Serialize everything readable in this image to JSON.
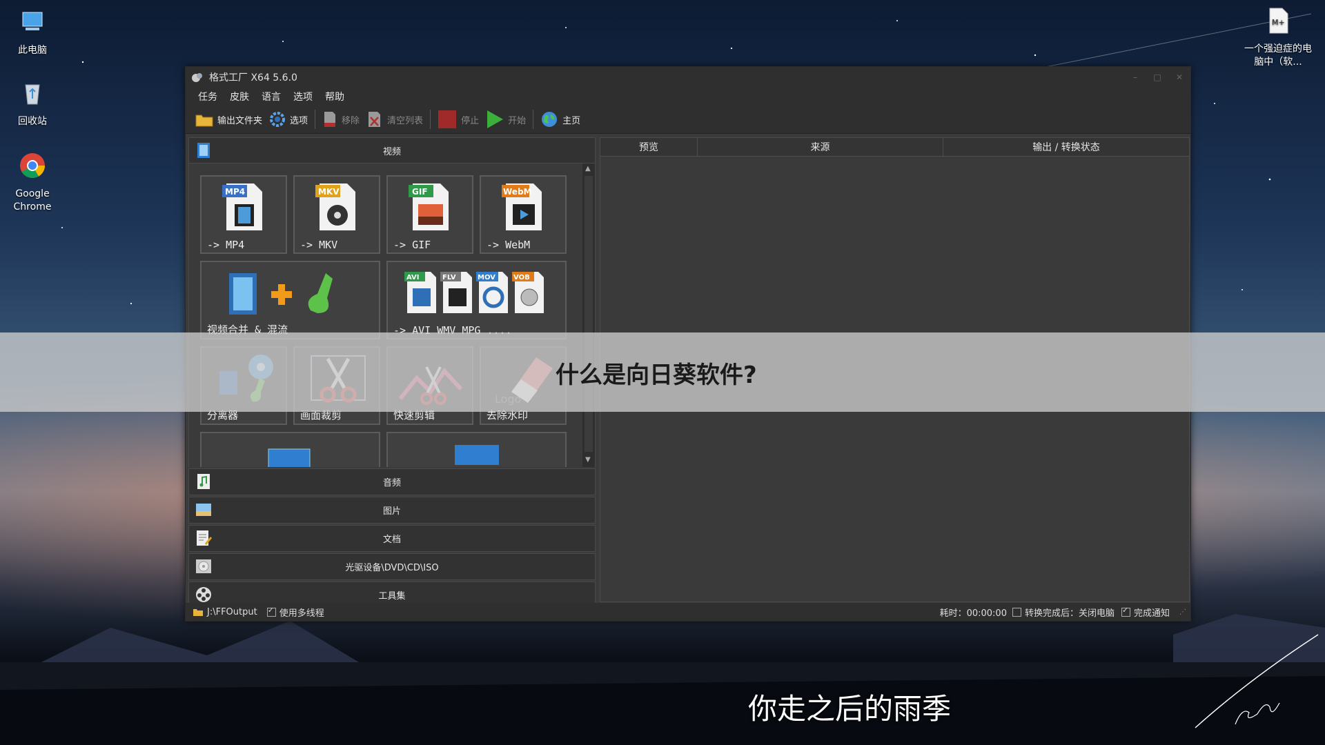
{
  "desktop": {
    "icons": [
      {
        "label": "此电脑"
      },
      {
        "label": "回收站"
      },
      {
        "label": "Google Chrome"
      },
      {
        "label": "一个强迫症的电脑中（软..."
      }
    ]
  },
  "window": {
    "title": "格式工厂 X64 5.6.0",
    "menu": [
      "任务",
      "皮肤",
      "语言",
      "选项",
      "帮助"
    ],
    "toolbar": {
      "output_folder": "输出文件夹",
      "options": "选项",
      "remove": "移除",
      "clear_list": "清空列表",
      "stop": "停止",
      "start": "开始",
      "home": "主页"
    },
    "categories": {
      "video": "视频",
      "audio": "音频",
      "image": "图片",
      "document": "文档",
      "disc": "光驱设备\\DVD\\CD\\ISO",
      "tools": "工具集"
    },
    "video_tiles": [
      {
        "label": "-> MP4",
        "badge": "MP4",
        "badge_color": "#3a6fc6"
      },
      {
        "label": "-> MKV",
        "badge": "MKV",
        "badge_color": "#e0a21a"
      },
      {
        "label": "-> GIF",
        "badge": "GIF",
        "badge_color": "#2e9a4a"
      },
      {
        "label": "-> WebM",
        "badge": "WebM",
        "badge_color": "#e07b1a"
      },
      {
        "label": "视频合并 & 混流"
      },
      {
        "label": "-> AVI WMV MPG ....",
        "badges": [
          "AVI",
          "FLV",
          "MOV",
          "VOB"
        ]
      },
      {
        "label": "分离器"
      },
      {
        "label": "画面裁剪"
      },
      {
        "label": "快速剪辑"
      },
      {
        "label": "去除水印"
      }
    ],
    "list_headers": [
      "预览",
      "来源",
      "输出 / 转换状态"
    ],
    "status": {
      "output_path": "J:\\FFOutput",
      "multithread": "使用多线程",
      "elapsed": "耗时：00:00:00",
      "after_convert": "转换完成后：关闭电脑",
      "notify": "完成通知"
    }
  },
  "overlay": {
    "banner_text": "什么是向日葵软件?",
    "subtitle": "你走之后的雨季"
  }
}
